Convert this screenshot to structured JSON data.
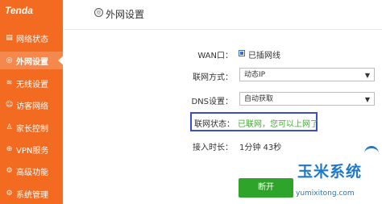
{
  "brand": {
    "logo": "Tenda",
    "accent": "#f26b21"
  },
  "sidebar": {
    "items": [
      {
        "label": "网络状态",
        "icon": "status-icon",
        "active": false
      },
      {
        "label": "外网设置",
        "icon": "globe-icon",
        "active": true
      },
      {
        "label": "无线设置",
        "icon": "wifi-icon",
        "active": false
      },
      {
        "label": "访客网络",
        "icon": "guest-icon",
        "active": false
      },
      {
        "label": "家长控制",
        "icon": "parental-icon",
        "active": false
      },
      {
        "label": "VPN服务",
        "icon": "vpn-icon",
        "active": false
      },
      {
        "label": "高级功能",
        "icon": "advanced-icon",
        "active": false
      },
      {
        "label": "系统管理",
        "icon": "system-icon",
        "active": false
      }
    ]
  },
  "header": {
    "title": "外网设置"
  },
  "form": {
    "wan_label": "WAN口：",
    "wan_value": "已插网线",
    "conn_label": "联网方式：",
    "conn_value": "动态IP",
    "dns_label": "DNS设置：",
    "dns_value": "自动获取",
    "status_label": "联网状态：",
    "status_value": "已联网，您可以上网了",
    "status_color": "#3fae2a",
    "duration_label": "接入时长：",
    "duration_value": "1分钟 43秒"
  },
  "buttons": {
    "disconnect": "断开",
    "disconnect_color": "#2fa42b"
  },
  "watermark": {
    "main": "玉米系统",
    "sub": "yumixitong.com",
    "color": "#1f78c8"
  }
}
